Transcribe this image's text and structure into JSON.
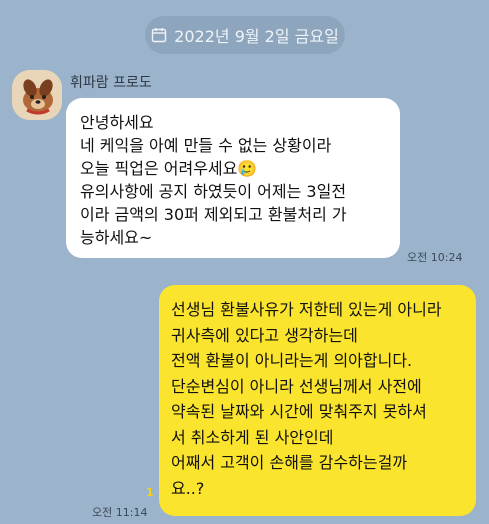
{
  "date_divider": {
    "icon": "calendar-icon",
    "text": "2022년 9월 2일 금요일"
  },
  "incoming": {
    "sender": "휘파람 프로도",
    "avatar_icon": "dog-avatar-icon",
    "text": "안녕하세요\n네 케익을 아예 만들 수 없는 상황이라\n오늘 픽업은 어려우세요🥲\n유의사항에 공지 하였듯이 어제는 3일전\n이라 금액의 30퍼 제외되고 환불처리 가\n능하세요~",
    "time": "오전 10:24"
  },
  "outgoing": {
    "text": "선생님 환불사유가 저한테 있는게 아니라\n귀사측에 있다고 생각하는데\n전액 환불이 아니라는게 의아합니다.\n단순변심이 아니라 선생님께서 사전에\n약속된 날짜와 시간에 맞춰주지 못하셔\n서 취소하게 된 사안인데\n어째서 고객이 손해를 감수하는걸까\n요..?",
    "unread_count": "1",
    "time": "오전 11:14"
  },
  "colors": {
    "background": "#9bb3cb",
    "incoming_bubble": "#ffffff",
    "outgoing_bubble": "#fbe42d"
  }
}
